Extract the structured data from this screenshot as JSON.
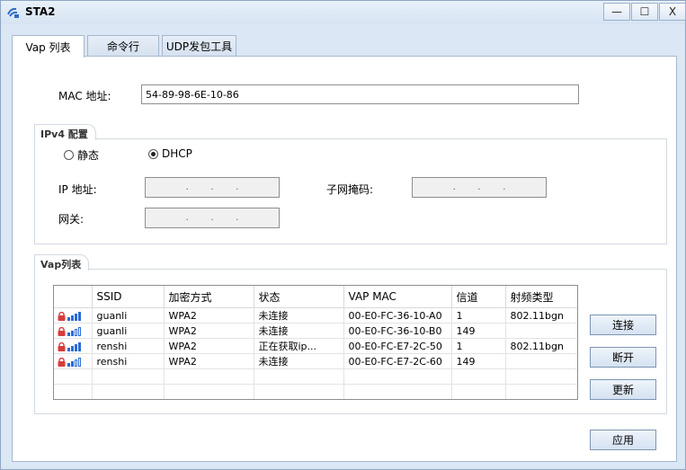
{
  "window": {
    "title": "STA2",
    "controls": {
      "minimize": "—",
      "maximize": "☐",
      "close": "X"
    }
  },
  "tabs": [
    {
      "label": "Vap 列表",
      "active": true
    },
    {
      "label": "命令行",
      "active": false
    },
    {
      "label": "UDP发包工具",
      "active": false
    }
  ],
  "mac": {
    "label": "MAC 地址:",
    "value": "54-89-98-6E-10-86"
  },
  "ipv4": {
    "group_label": "IPv4 配置",
    "radio_static": "静态",
    "radio_dhcp": "DHCP",
    "selected": "DHCP",
    "ip_label": "IP 地址:",
    "mask_label": "子网掩码:",
    "gateway_label": "网关:"
  },
  "vap": {
    "group_label": "Vap列表",
    "columns": [
      "",
      "SSID",
      "加密方式",
      "状态",
      "VAP MAC",
      "信道",
      "射频类型"
    ],
    "rows": [
      {
        "ssid": "guanli",
        "encryption": "WPA2",
        "status": "未连接",
        "vap_mac": "00-E0-FC-36-10-A0",
        "channel": "1",
        "radio": "802.11bgn",
        "signal": 4
      },
      {
        "ssid": "guanli",
        "encryption": "WPA2",
        "status": "未连接",
        "vap_mac": "00-E0-FC-36-10-B0",
        "channel": "149",
        "radio": "",
        "signal": 2
      },
      {
        "ssid": "renshi",
        "encryption": "WPA2",
        "status": "正在获取ip...",
        "vap_mac": "00-E0-FC-E7-2C-50",
        "channel": "1",
        "radio": "802.11bgn",
        "signal": 4
      },
      {
        "ssid": "renshi",
        "encryption": "WPA2",
        "status": "未连接",
        "vap_mac": "00-E0-FC-E7-2C-60",
        "channel": "149",
        "radio": "",
        "signal": 2
      }
    ]
  },
  "buttons": {
    "connect": "连接",
    "disconnect": "断开",
    "refresh": "更新",
    "apply": "应用"
  },
  "colors": {
    "accent": "#2b6bd6",
    "lock": "#d93b3b",
    "window_bg": "#dbe7f4"
  }
}
